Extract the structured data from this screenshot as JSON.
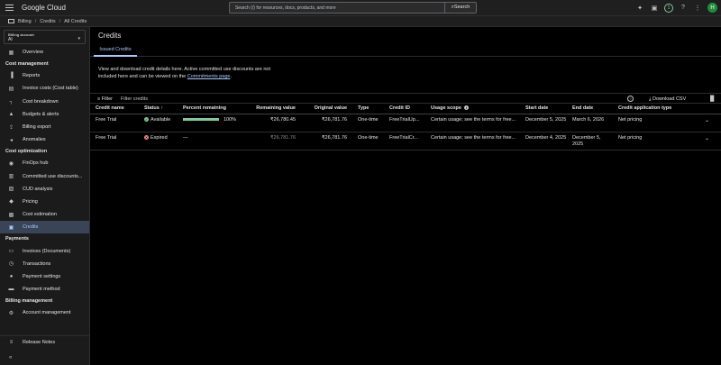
{
  "topbar": {
    "logo": "Google Cloud",
    "search_placeholder": "Search (/) for resources, docs, products, and more",
    "search_button": "Search",
    "notifications_count": "1",
    "avatar_letter": "H"
  },
  "breadcrumb": {
    "items": [
      "Billing",
      "Credits",
      "All Credits"
    ],
    "separator": "/"
  },
  "sidebar": {
    "billing_account_label": "Billing account",
    "billing_account_value": "AI",
    "overview": "Overview",
    "sections": {
      "cost_management": "Cost management",
      "cost_optimization": "Cost optimization",
      "payments": "Payments",
      "billing_management": "Billing management"
    },
    "cost_management_items": [
      "Reports",
      "Invoice costs (Cost table)",
      "Cost breakdown",
      "Budgets & alerts",
      "Billing export",
      "Anomalies"
    ],
    "cost_optimization_items": [
      "FinOps hub",
      "Committed use discounts...",
      "CUD analysis",
      "Pricing",
      "Cost estimation",
      "Credits"
    ],
    "payments_items": [
      "Invoices (Documents)",
      "Transactions",
      "Payment settings",
      "Payment method"
    ],
    "billing_management_items": [
      "Account management"
    ],
    "release_notes": "Release Notes"
  },
  "main": {
    "title": "Credits",
    "tab": "Issued Credits",
    "description": "View and download credit details here. Active committed use discounts are not included here and can be viewed on the",
    "description_link": "Commitments page",
    "description_end": ".",
    "filter_label": "Filter",
    "filter_placeholder": "Filter credits",
    "download_label": "Download CSV",
    "columns": [
      "Credit name",
      "Status",
      "Percent remaining",
      "Remaining value",
      "Original value",
      "Type",
      "Credit ID",
      "Usage scope",
      "Start date",
      "End date",
      "Credit application type"
    ],
    "rows": [
      {
        "name": "Free Trial",
        "status": "Available",
        "status_kind": "ok",
        "percent_label": "100%",
        "percent_value": 100,
        "remaining": "₹26,780.45",
        "original": "₹26,781.76",
        "type": "One-time",
        "credit_id": "FreeTrialUp...",
        "usage_scope": "Certain usage; see the terms for free...",
        "start": "December 5, 2025",
        "end": "March 6, 2026",
        "application": "Net pricing"
      },
      {
        "name": "Free Trial",
        "status": "Expired",
        "status_kind": "err",
        "percent_label": "—",
        "percent_value": null,
        "remaining": "₹26,781.76",
        "original": "₹26,781.76",
        "type": "One-time",
        "credit_id": "FreeTrialCr...",
        "usage_scope": "Certain usage; see the terms for free...",
        "start": "December 4, 2025",
        "end": "December 5, 2025",
        "application": "Net pricing"
      }
    ]
  },
  "colors": {
    "accent": "#a8c7fa",
    "success": "#81c995",
    "error": "#f28b82",
    "active_nav_bg": "#394457"
  }
}
